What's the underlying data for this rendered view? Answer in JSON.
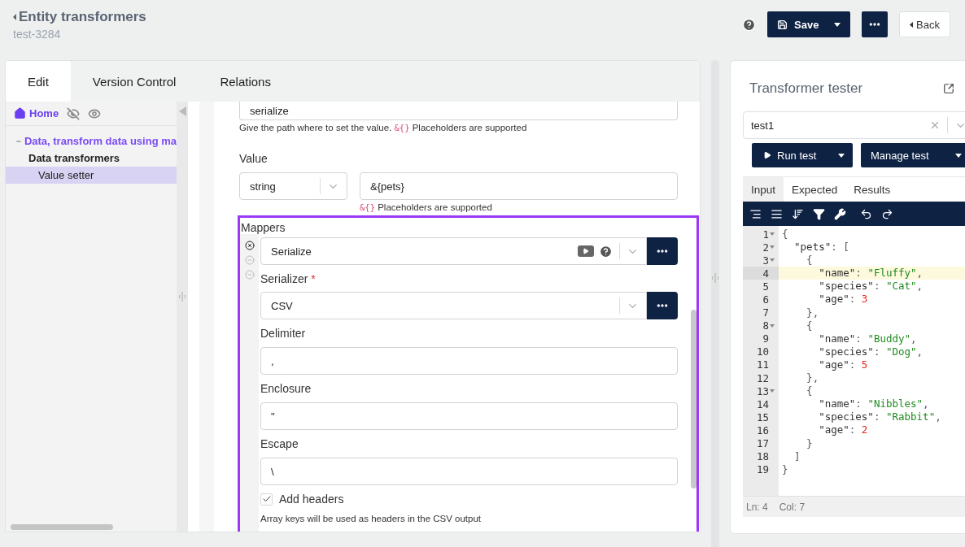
{
  "header": {
    "title": "Entity transformers",
    "subtitle": "test-3284",
    "save_label": "Save",
    "back_label": "Back"
  },
  "tabs": [
    {
      "label": "Edit",
      "selected": true
    },
    {
      "label": "Version Control",
      "selected": false
    },
    {
      "label": "Relations",
      "selected": false
    }
  ],
  "sidebar": {
    "home": "Home",
    "items": [
      {
        "label": "Data, transform data using ma",
        "expanded": true,
        "selected": false,
        "children": [
          {
            "label": "Data transformers",
            "selected": false,
            "children": [
              {
                "label": "Value setter",
                "selected": true
              }
            ]
          }
        ]
      }
    ]
  },
  "form": {
    "path": {
      "value": "serialize",
      "help": [
        {
          "text": "Give the path where to set the value.",
          "kind": "plain"
        },
        {
          "text": "&{}",
          "kind": "code"
        },
        {
          "text": "Placeholders are supported",
          "kind": "plain"
        }
      ]
    },
    "value": {
      "label": "Value",
      "type": "string",
      "input": "&{pets}",
      "help": [
        {
          "text": "&{}",
          "kind": "code"
        },
        {
          "text": "Placeholders are supported",
          "kind": "plain"
        }
      ]
    },
    "mappers": {
      "label": "Mappers",
      "mapper": {
        "value": "Serialize"
      },
      "serializer": {
        "label": "Serializer",
        "required": true,
        "required_mark": "*",
        "value": "CSV"
      },
      "fields": [
        {
          "label": "Delimiter",
          "value": ","
        },
        {
          "label": "Enclosure",
          "value": "\""
        },
        {
          "label": "Escape",
          "value": "\\"
        }
      ],
      "add_headers": {
        "label": "Add headers",
        "checked": true
      },
      "note": "Array keys will be used as headers in the CSV output"
    }
  },
  "tester": {
    "title": "Transformer tester",
    "test": "test1",
    "run_label": "Run test",
    "manage_label": "Manage test",
    "tabs": [
      {
        "label": "Input",
        "selected": true
      },
      {
        "label": "Expected",
        "selected": false
      },
      {
        "label": "Results",
        "selected": false
      }
    ],
    "code": [
      {
        "number": "1",
        "fold": true,
        "active": false,
        "tokens": [
          {
            "text": "{",
            "kind": "punct"
          }
        ]
      },
      {
        "number": "2",
        "fold": true,
        "active": false,
        "tokens": [
          {
            "text": "  \"pets\"",
            "kind": "key"
          },
          {
            "text": ": [",
            "kind": "punct"
          }
        ]
      },
      {
        "number": "3",
        "fold": true,
        "active": false,
        "tokens": [
          {
            "text": "    {",
            "kind": "punct"
          }
        ]
      },
      {
        "number": "4",
        "fold": false,
        "active": true,
        "tokens": [
          {
            "text": "      \"name\"",
            "kind": "key"
          },
          {
            "text": ": ",
            "kind": "punct"
          },
          {
            "text": "\"Fluffy\"",
            "kind": "string"
          },
          {
            "text": ",",
            "kind": "punct"
          }
        ]
      },
      {
        "number": "5",
        "fold": false,
        "active": false,
        "tokens": [
          {
            "text": "      \"species\"",
            "kind": "key"
          },
          {
            "text": ": ",
            "kind": "punct"
          },
          {
            "text": "\"Cat\"",
            "kind": "string"
          },
          {
            "text": ",",
            "kind": "punct"
          }
        ]
      },
      {
        "number": "6",
        "fold": false,
        "active": false,
        "tokens": [
          {
            "text": "      \"age\"",
            "kind": "key"
          },
          {
            "text": ": ",
            "kind": "punct"
          },
          {
            "text": "3",
            "kind": "number"
          }
        ]
      },
      {
        "number": "7",
        "fold": false,
        "active": false,
        "tokens": [
          {
            "text": "    },",
            "kind": "punct"
          }
        ]
      },
      {
        "number": "8",
        "fold": true,
        "active": false,
        "tokens": [
          {
            "text": "    {",
            "kind": "punct"
          }
        ]
      },
      {
        "number": "9",
        "fold": false,
        "active": false,
        "tokens": [
          {
            "text": "      \"name\"",
            "kind": "key"
          },
          {
            "text": ": ",
            "kind": "punct"
          },
          {
            "text": "\"Buddy\"",
            "kind": "string"
          },
          {
            "text": ",",
            "kind": "punct"
          }
        ]
      },
      {
        "number": "10",
        "fold": false,
        "active": false,
        "tokens": [
          {
            "text": "      \"species\"",
            "kind": "key"
          },
          {
            "text": ": ",
            "kind": "punct"
          },
          {
            "text": "\"Dog\"",
            "kind": "string"
          },
          {
            "text": ",",
            "kind": "punct"
          }
        ]
      },
      {
        "number": "11",
        "fold": false,
        "active": false,
        "tokens": [
          {
            "text": "      \"age\"",
            "kind": "key"
          },
          {
            "text": ": ",
            "kind": "punct"
          },
          {
            "text": "5",
            "kind": "number"
          }
        ]
      },
      {
        "number": "12",
        "fold": false,
        "active": false,
        "tokens": [
          {
            "text": "    },",
            "kind": "punct"
          }
        ]
      },
      {
        "number": "13",
        "fold": true,
        "active": false,
        "tokens": [
          {
            "text": "    {",
            "kind": "punct"
          }
        ]
      },
      {
        "number": "14",
        "fold": false,
        "active": false,
        "tokens": [
          {
            "text": "      \"name\"",
            "kind": "key"
          },
          {
            "text": ": ",
            "kind": "punct"
          },
          {
            "text": "\"Nibbles\"",
            "kind": "string"
          },
          {
            "text": ",",
            "kind": "punct"
          }
        ]
      },
      {
        "number": "15",
        "fold": false,
        "active": false,
        "tokens": [
          {
            "text": "      \"species\"",
            "kind": "key"
          },
          {
            "text": ": ",
            "kind": "punct"
          },
          {
            "text": "\"Rabbit\"",
            "kind": "string"
          },
          {
            "text": ",",
            "kind": "punct"
          }
        ]
      },
      {
        "number": "16",
        "fold": false,
        "active": false,
        "tokens": [
          {
            "text": "      \"age\"",
            "kind": "key"
          },
          {
            "text": ": ",
            "kind": "punct"
          },
          {
            "text": "2",
            "kind": "number"
          }
        ]
      },
      {
        "number": "17",
        "fold": false,
        "active": false,
        "tokens": [
          {
            "text": "    }",
            "kind": "punct"
          }
        ]
      },
      {
        "number": "18",
        "fold": false,
        "active": false,
        "tokens": [
          {
            "text": "  ]",
            "kind": "punct"
          }
        ]
      },
      {
        "number": "19",
        "fold": false,
        "active": false,
        "tokens": [
          {
            "text": "}",
            "kind": "punct"
          }
        ]
      }
    ],
    "status": {
      "line": "Ln: 4",
      "col": "Col: 7"
    }
  }
}
